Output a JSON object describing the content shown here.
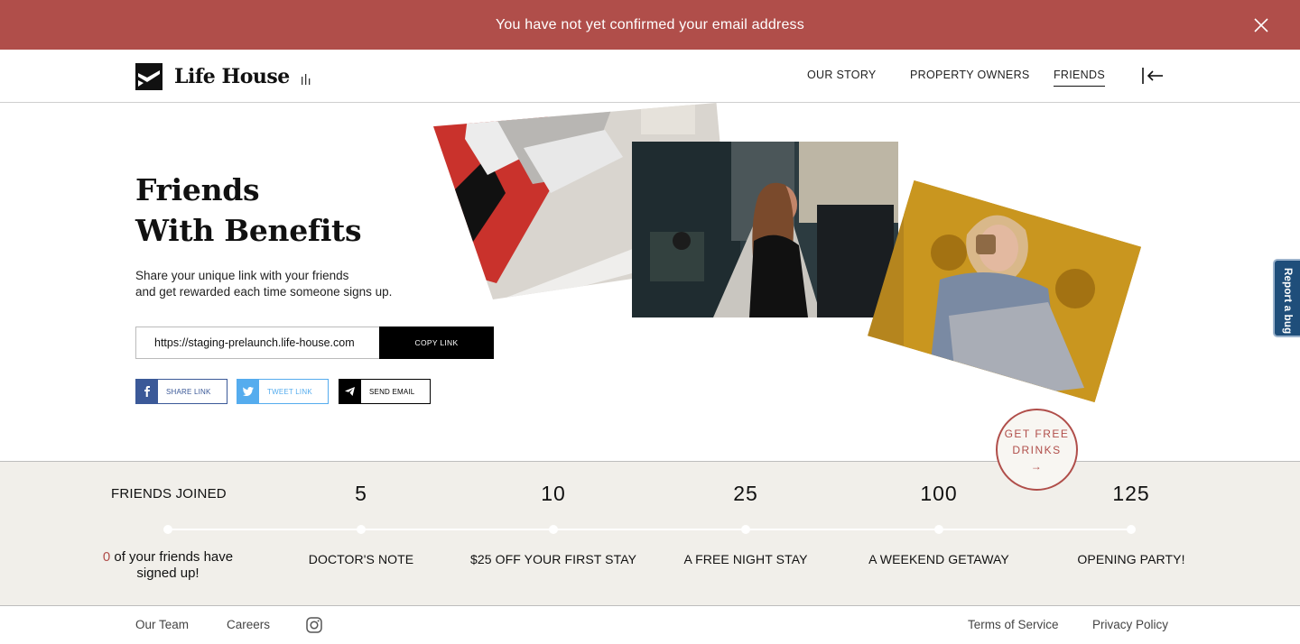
{
  "banner": {
    "message": "You have not yet confirmed your email address",
    "close_icon": "close-icon"
  },
  "header": {
    "logo_text": "Life House",
    "nav": [
      "OUR STORY",
      "PROPERTY OWNERS",
      "FRIENDS"
    ],
    "active_nav": "FRIENDS",
    "collapse_icon": "collapse-left-icon"
  },
  "hero": {
    "title_line1": "Friends",
    "title_line2": "With Benefits",
    "desc_line1": "Share your unique link with your friends",
    "desc_line2": "and get rewarded each time someone signs up.",
    "link_value": "https://staging-prelaunch.life-house.com",
    "copy_label": "COPY LINK",
    "share_facebook": "SHARE LINK",
    "share_twitter": "TWEET LINK",
    "share_email": "SEND EMAIL"
  },
  "colors": {
    "accent": "#b04e4a",
    "facebook": "#3b5998",
    "twitter": "#55acee",
    "bug_tab": "#1f4e7a",
    "rewards_bg": "#f1efea"
  },
  "rewards": {
    "label": "FRIENDS JOINED",
    "friends_count": "0",
    "signed_text_1": " of your friends have",
    "signed_text_2": "signed up!",
    "tiers": [
      {
        "count": "5",
        "reward": "DOCTOR'S NOTE"
      },
      {
        "count": "10",
        "reward": "$25 OFF YOUR FIRST STAY"
      },
      {
        "count": "25",
        "reward": "A FREE NIGHT STAY"
      },
      {
        "count": "100",
        "reward": "A WEEKEND GETAWAY"
      },
      {
        "count": "125",
        "reward": "OPENING PARTY!"
      }
    ]
  },
  "free_drinks": {
    "line1": "GET FREE",
    "line2": "DRINKS",
    "arrow": "→"
  },
  "bug_tab": {
    "label": "Report a bug"
  },
  "footer": {
    "links_left": [
      "Our Team",
      "Careers"
    ],
    "links_right": [
      "Terms of Service",
      "Privacy Policy"
    ],
    "social_icon": "instagram-icon"
  }
}
